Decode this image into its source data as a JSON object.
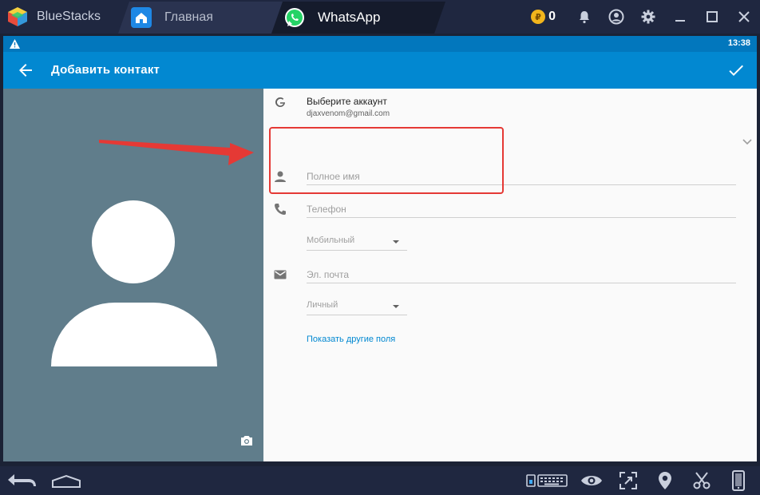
{
  "titlebar": {
    "app_name": "BlueStacks",
    "tabs": [
      {
        "label": "Главная",
        "icon": "home-icon"
      },
      {
        "label": "WhatsApp",
        "icon": "whatsapp-icon",
        "active": true
      }
    ],
    "coin_symbol": "₽",
    "coins": "0",
    "buttons": [
      "bell-icon",
      "account-icon",
      "gear-icon",
      "minimize-icon",
      "maximize-icon",
      "close-icon"
    ]
  },
  "statusbar": {
    "time": "13:38"
  },
  "appbar": {
    "title": "Добавить контакт"
  },
  "account": {
    "title": "Выберите аккаунт",
    "email": "djaxvenom@gmail.com"
  },
  "form": {
    "name_placeholder": "Полное имя",
    "phone_placeholder": "Телефон",
    "phone_type": "Мобильный",
    "email_placeholder": "Эл. почта",
    "email_type": "Личный",
    "more_fields": "Показать другие поля"
  },
  "colors": {
    "accent": "#0288d1",
    "statusbar": "#0277bd",
    "photo_bg": "#607d8b",
    "highlight": "#e53935",
    "chrome": "#1f2740"
  }
}
